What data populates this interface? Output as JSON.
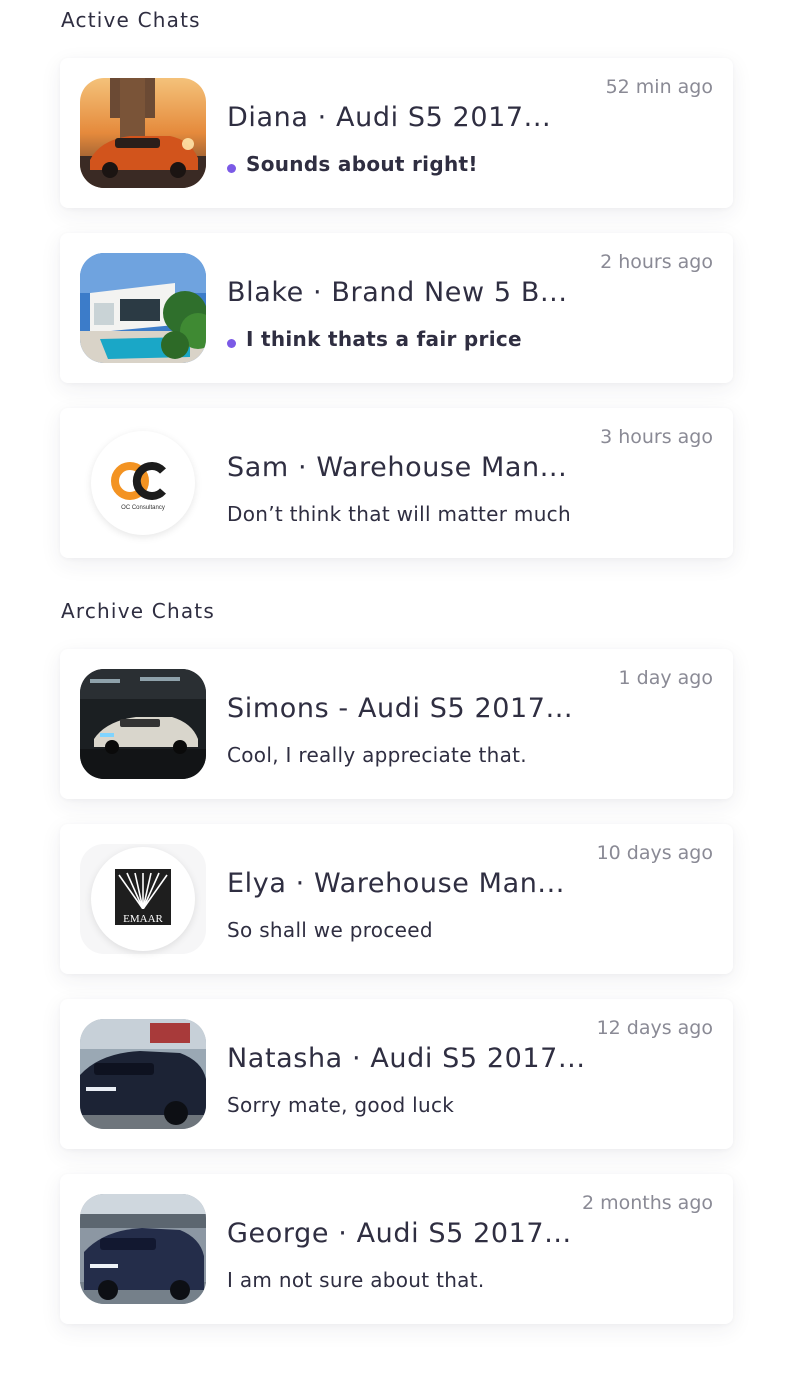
{
  "active_section": {
    "title": "Active Chats",
    "chats": [
      {
        "name": "Diana · Audi S5 2017...",
        "time": "52 min ago",
        "preview": "Sounds about right!",
        "unread": true
      },
      {
        "name": "Blake · Brand New 5 B...",
        "time": "2 hours ago",
        "preview": "I think thats a fair price",
        "unread": true
      },
      {
        "name": "Sam · Warehouse Man...",
        "time": "3 hours ago",
        "preview": "Don’t think that will matter much",
        "unread": false,
        "logo_text": "OC Consultancy"
      }
    ]
  },
  "archive_section": {
    "title": "Archive Chats",
    "chats": [
      {
        "name": "Simons - Audi S5 2017...",
        "time": "1 day ago",
        "preview": "Cool, I really appreciate that.",
        "unread": false
      },
      {
        "name": "Elya · Warehouse Man...",
        "time": "10 days ago",
        "preview": "So shall we proceed",
        "unread": false,
        "logo_text": "EMAAR"
      },
      {
        "name": "Natasha · Audi S5 2017...",
        "time": "12 days ago",
        "preview": "Sorry mate, good luck",
        "unread": false
      },
      {
        "name": "George · Audi S5 2017...",
        "time": "2 months ago",
        "preview": "I am not sure about that.",
        "unread": false
      }
    ]
  },
  "colors": {
    "unread_dot": "#7b5ae6",
    "text_primary": "#2f2e41",
    "text_muted": "#8a8a95",
    "oc_orange": "#f39322"
  }
}
